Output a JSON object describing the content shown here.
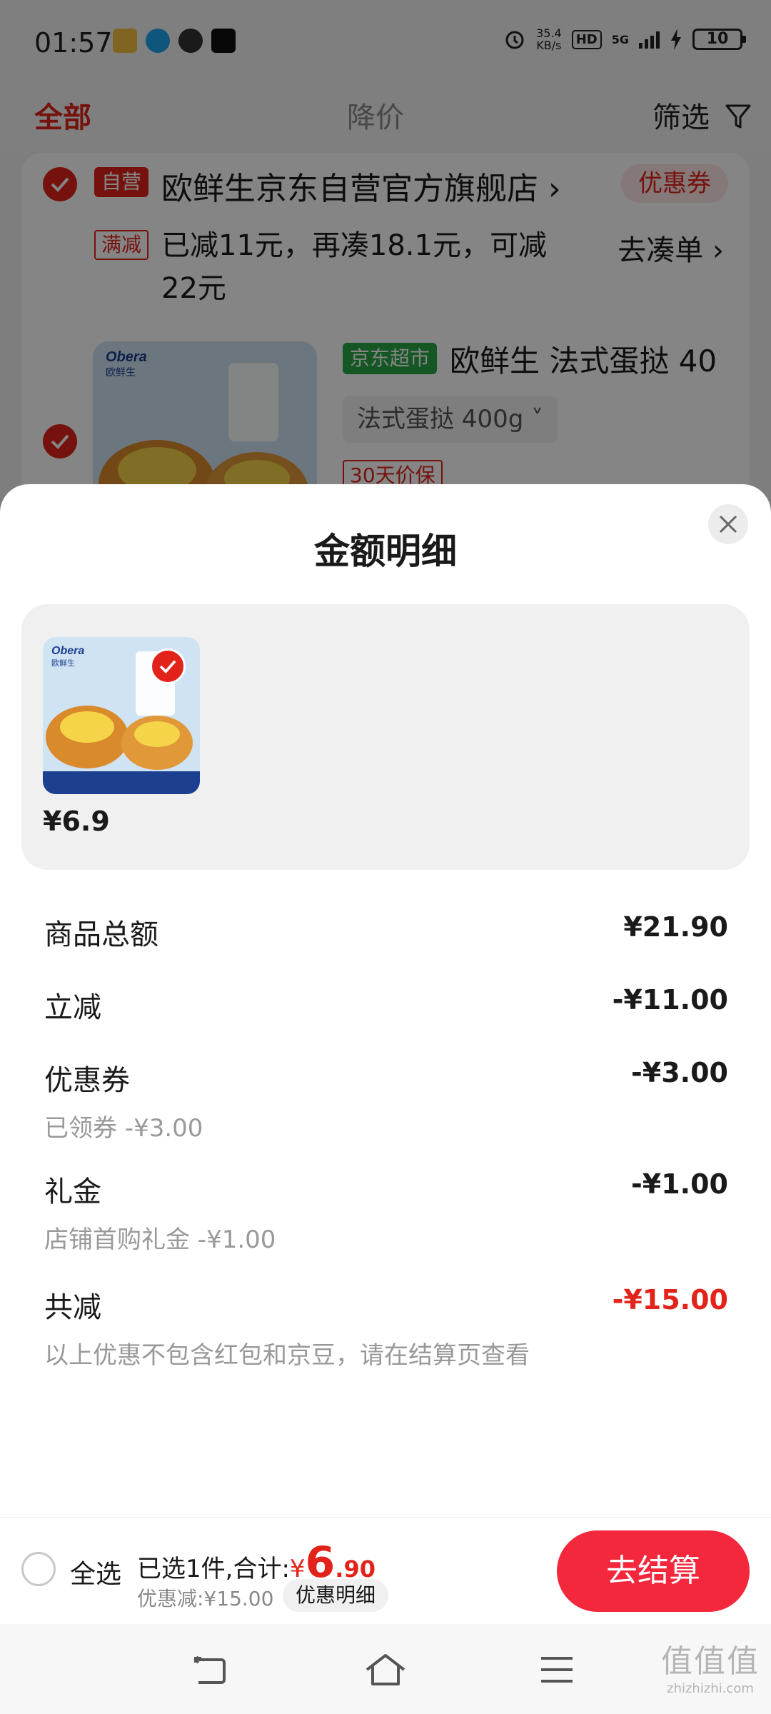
{
  "status_bar": {
    "time": "01:57",
    "net_speed_value": "35.4",
    "net_speed_unit": "KB/s",
    "hd_label": "HD",
    "network": "5G",
    "battery": "10"
  },
  "tabs": {
    "all": "全部",
    "price_drop": "降价",
    "filter": "筛选"
  },
  "store": {
    "self_tag": "自营",
    "name": "欧鲜生京东自营官方旗舰店 ›",
    "coupon": "优惠券",
    "full_reduction_tag": "满减",
    "promo_text": "已减11元，再凑18.1元，可减22元",
    "collect_link": "去凑单 ›"
  },
  "product": {
    "market_tag": "京东超市",
    "title": "欧鲜生 法式蛋挞 40",
    "spec": "法式蛋挞 400g ˅",
    "price_protect_tag": "30天价保",
    "brand_en": "Obera",
    "brand_cn": "欧鲜生"
  },
  "sheet": {
    "title": "金额明细",
    "item_price": "¥6.9",
    "rows": [
      {
        "label": "商品总额",
        "value": "¥21.90"
      },
      {
        "label": "立减",
        "value": "-¥11.00"
      },
      {
        "label": "优惠券",
        "value": "-¥3.00",
        "sub": "已领券 -¥3.00"
      },
      {
        "label": "礼金",
        "value": "-¥1.00",
        "sub": "店铺首购礼金 -¥1.00"
      },
      {
        "label": "共减",
        "value": "-¥15.00",
        "sub": "以上优惠不包含红包和京豆，请在结算页查看"
      }
    ]
  },
  "bottom": {
    "select_all": "全选",
    "selected_prefix": "已选1件,合计:",
    "currency": "¥",
    "total_int": "6",
    "total_dec": ".90",
    "discount": "优惠减:¥15.00",
    "detail_chip": "优惠明细",
    "checkout": "去结算"
  },
  "watermark": {
    "top": "值值值",
    "bottom": "zhizhizhi.com"
  },
  "colors": {
    "accent": "#e2231a",
    "checkout": "#f4283c",
    "market": "#2aa845"
  }
}
